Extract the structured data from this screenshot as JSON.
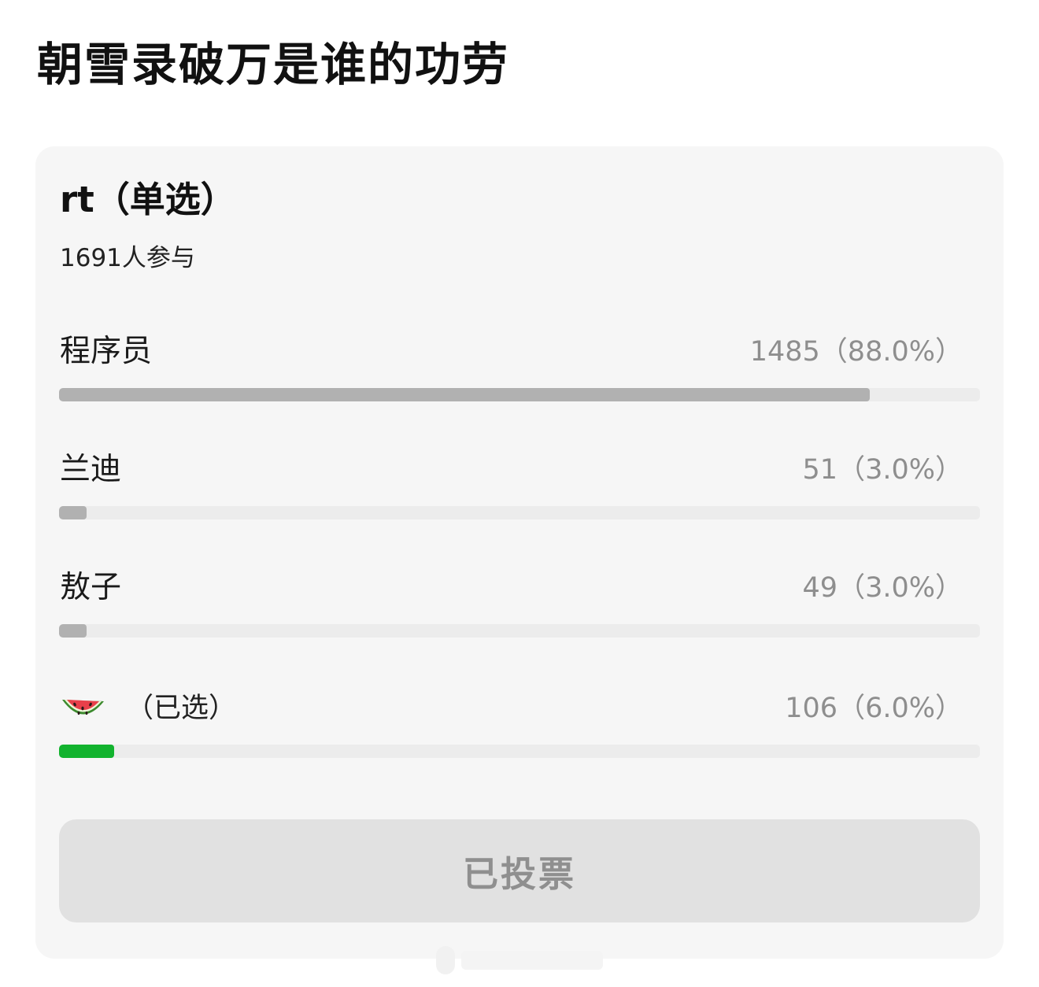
{
  "page": {
    "title": "朝雪录破万是谁的功劳"
  },
  "poll": {
    "question": "rt（单选）",
    "participants": "1691人参与",
    "options": [
      {
        "label": "程序员",
        "count": "1485（88.0%）",
        "percent": 88.0,
        "selected": false
      },
      {
        "label": "兰迪",
        "count": "51（3.0%）",
        "percent": 3.0,
        "selected": false
      },
      {
        "label": "敖子",
        "count": "49（3.0%）",
        "percent": 3.0,
        "selected": false
      },
      {
        "label": "",
        "icon": "watermelon-emoji",
        "selected_mark": "（已选）",
        "count": "106（6.0%）",
        "percent": 6.0,
        "selected": true
      }
    ],
    "vote_button": "已投票"
  },
  "colors": {
    "bar_default": "#b1b1b1",
    "bar_selected": "#12b32e",
    "track": "#ececec",
    "card_background": "#f6f6f6",
    "button_background": "#e1e1e1",
    "button_text": "#8f8f8f"
  }
}
